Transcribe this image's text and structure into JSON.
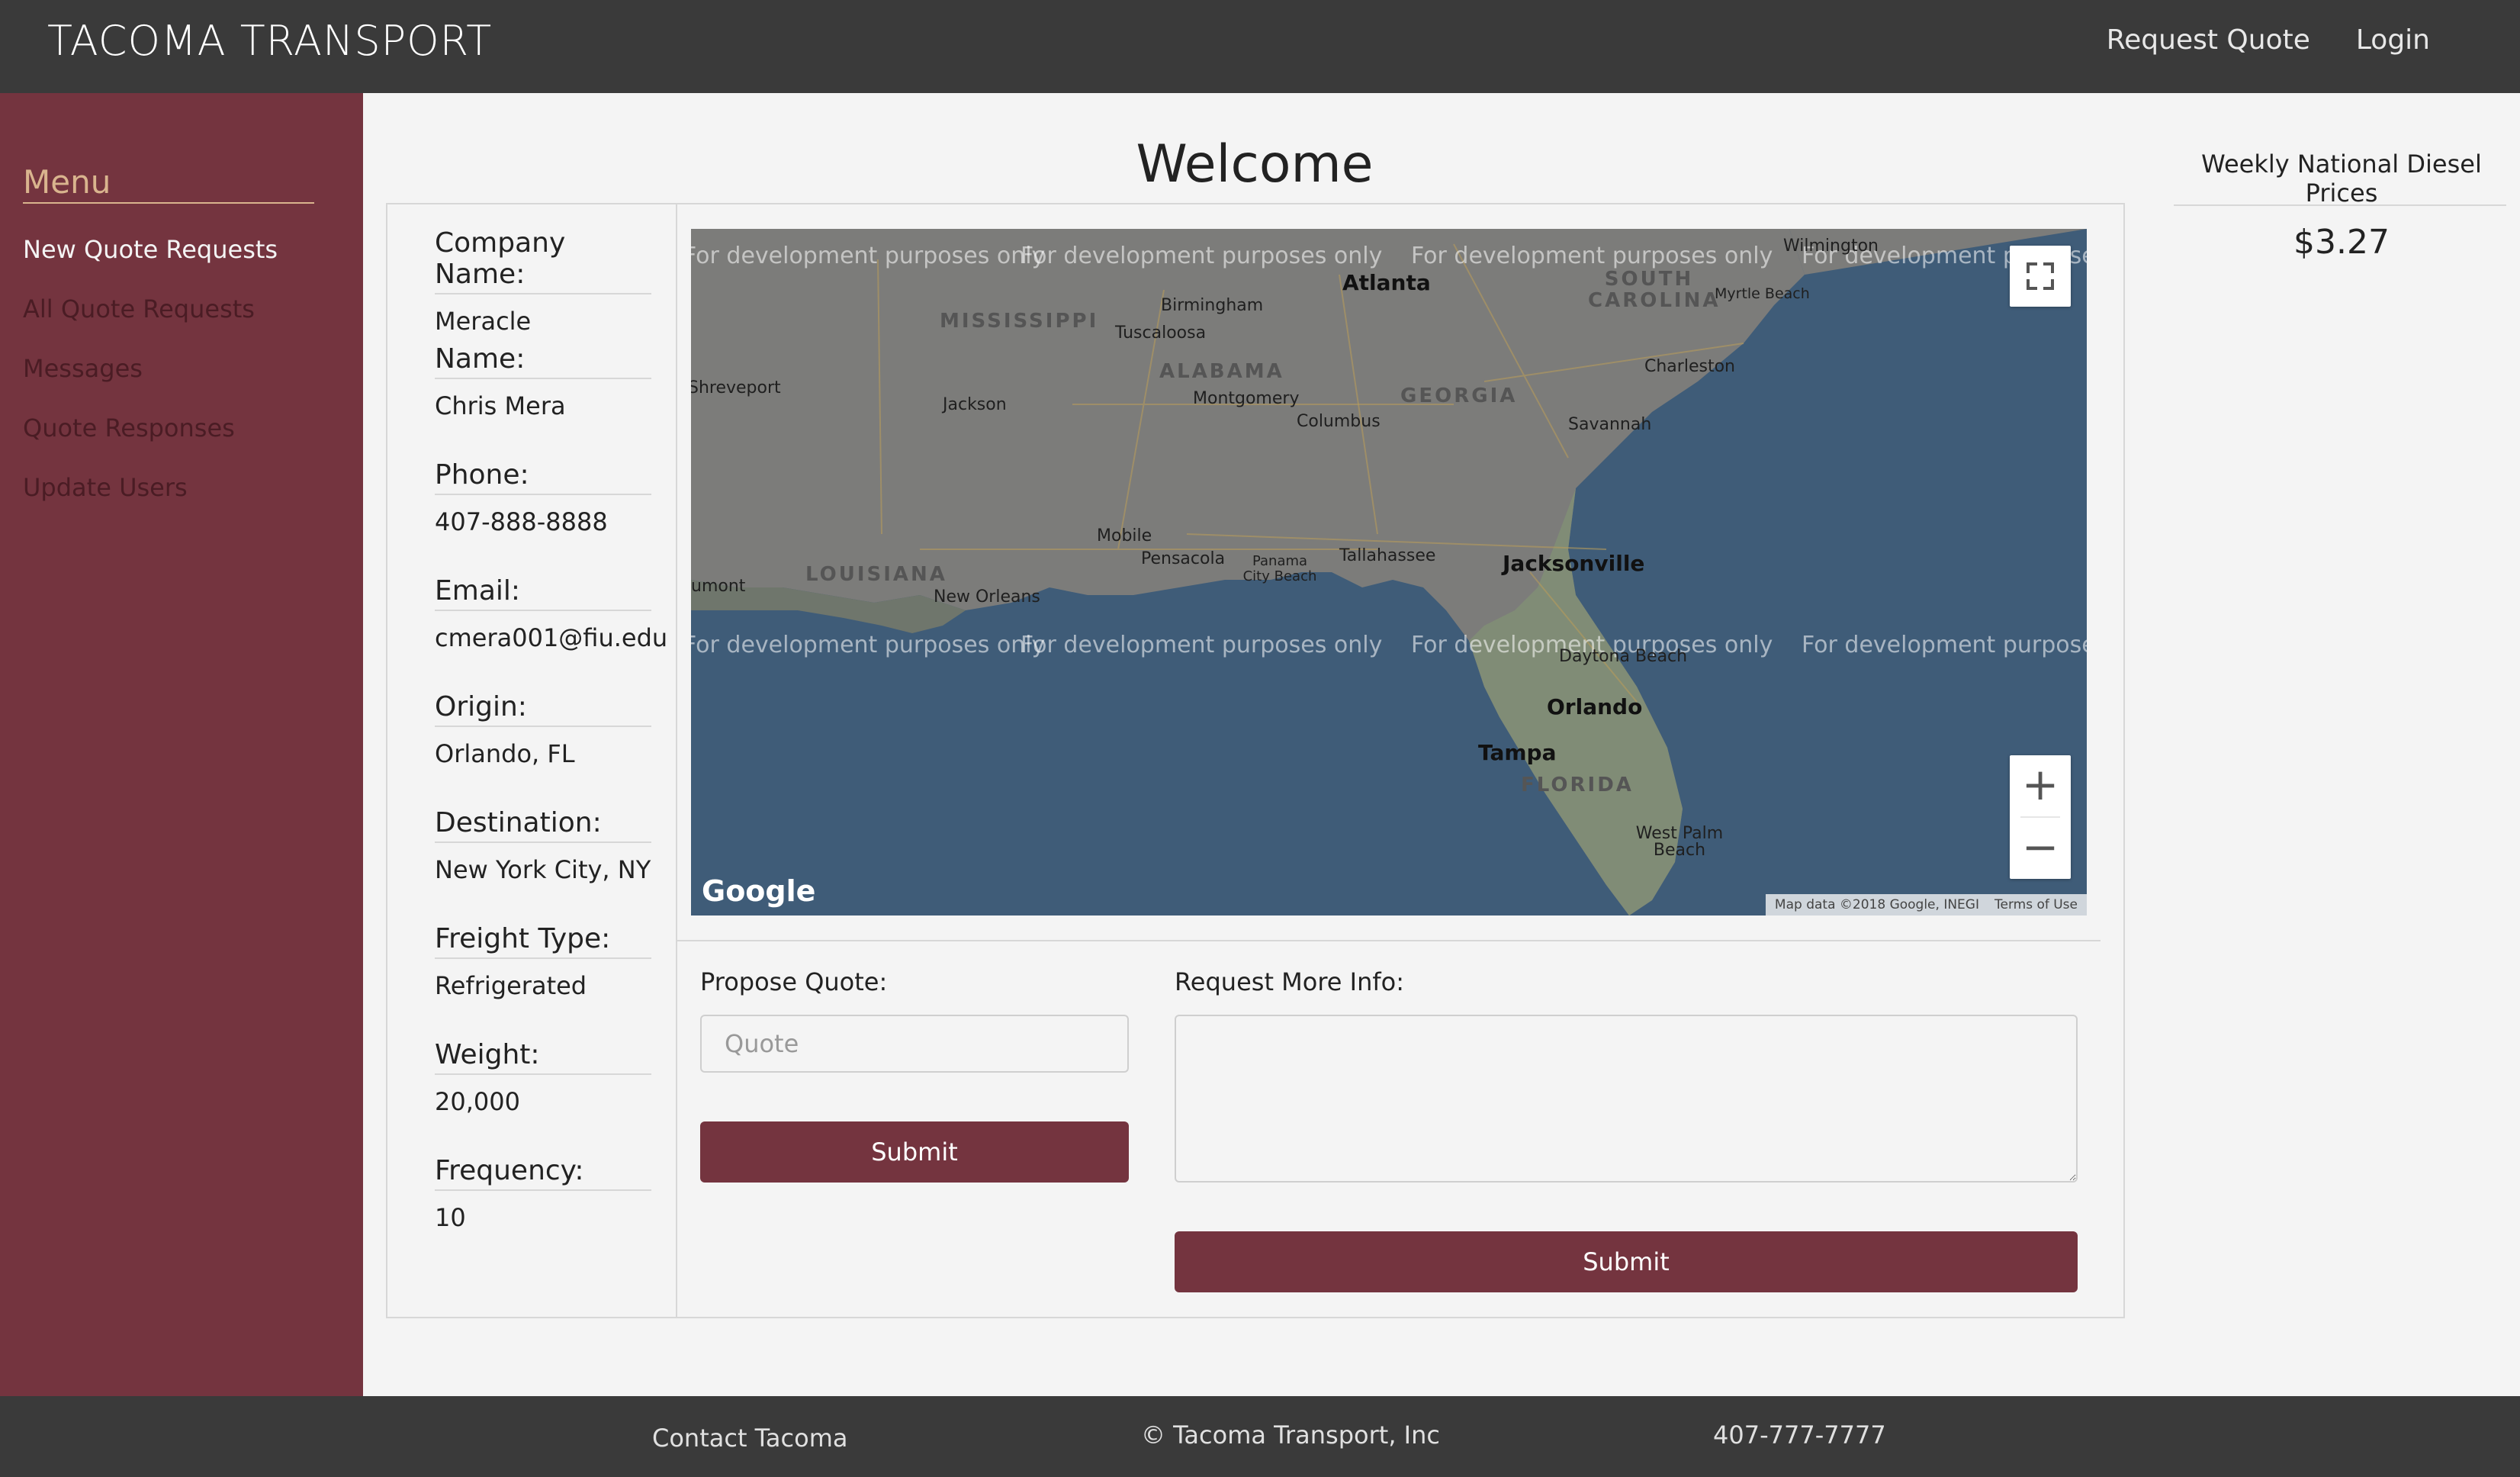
{
  "header": {
    "brand": "TACOMA TRANSPORT",
    "nav": [
      "Request Quote",
      "Login"
    ]
  },
  "sidebar": {
    "title": "Menu",
    "items": [
      {
        "label": "New Quote Requests",
        "active": true
      },
      {
        "label": "All Quote Requests",
        "active": false
      },
      {
        "label": "Messages",
        "active": false
      },
      {
        "label": "Quote Responses",
        "active": false
      },
      {
        "label": "Update Users",
        "active": false
      }
    ]
  },
  "main": {
    "title": "Welcome",
    "details": [
      {
        "label": "Company Name:",
        "value": "Meracle"
      },
      {
        "label": "Name:",
        "value": "Chris Mera"
      },
      {
        "label": "Phone:",
        "value": "407-888-8888"
      },
      {
        "label": "Email:",
        "value": "cmera001@fiu.edu"
      },
      {
        "label": "Origin:",
        "value": "Orlando, FL"
      },
      {
        "label": "Destination:",
        "value": "New York City, NY"
      },
      {
        "label": "Freight Type:",
        "value": "Refrigerated"
      },
      {
        "label": "Weight:",
        "value": "20,000"
      },
      {
        "label": "Frequency:",
        "value": "10"
      }
    ],
    "map": {
      "watermark": "For development purposes only",
      "logo": "Google",
      "attribution": "Map data ©2018 Google, INEGI",
      "terms": "Terms of Use",
      "zoom_in": "+",
      "zoom_out": "−",
      "states": [
        "MISSISSIPPI",
        "ALABAMA",
        "GEORGIA",
        "SOUTH CAROLINA",
        "LOUISIANA",
        "FLORIDA"
      ],
      "cities": [
        "Atlanta",
        "Birmingham",
        "Tuscaloosa",
        "Jackson",
        "Montgomery",
        "Columbus",
        "Savannah",
        "Charleston",
        "Myrtle Beach",
        "Wilmington",
        "Shreveport",
        "Mobile",
        "Pensacola",
        "Panama City Beach",
        "Tallahassee",
        "Jacksonville",
        "New Orleans",
        "Daytona Beach",
        "Orlando",
        "Tampa",
        "West Palm Beach",
        "umont"
      ]
    },
    "quote": {
      "label": "Propose Quote:",
      "placeholder": "Quote",
      "submit": "Submit"
    },
    "more_info": {
      "label": "Request More Info:",
      "submit": "Submit"
    }
  },
  "diesel": {
    "title": "Weekly National Diesel Prices",
    "price": "$3.27"
  },
  "footer": {
    "contact": "Contact Tacoma",
    "copyright": "© Tacoma Transport, Inc",
    "phone": "407-777-7777"
  },
  "colors": {
    "header_bg": "#3a3a3a",
    "sidebar_bg": "#74343f",
    "accent": "#74343f",
    "menu_title": "#d9b48e",
    "map_water": "#3f5c78"
  }
}
